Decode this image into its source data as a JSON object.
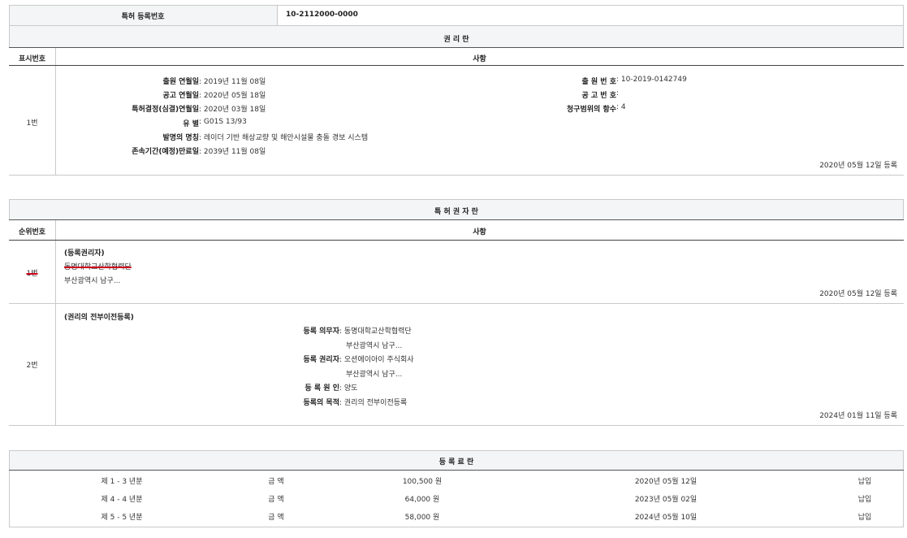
{
  "patent_number": {
    "label": "특허 등록번호",
    "value": "10-2112000-0000"
  },
  "rights_section": {
    "title": "권 리 란",
    "col_no": "표시번호",
    "col_content": "사항",
    "row": {
      "no": "1번",
      "left": [
        {
          "label": "출원 연월일",
          "value": "2019년 11월 08일"
        },
        {
          "label": "공고 연월일",
          "value": "2020년 05월 18일"
        },
        {
          "label": "특허결정(심결)연월일",
          "value": "2020년 03월 18일"
        },
        {
          "label": "유 별",
          "value": "G01S 13/93"
        },
        {
          "label": "발명의 명칭",
          "value": "레이더 기반 해상교량 및 해안시설물 충돌 경보 시스템"
        },
        {
          "label": "존속기간(예정)만료일",
          "value": "2039년 11월 08일"
        }
      ],
      "right": [
        {
          "label": "출 원 번 호",
          "value": "10-2019-0142749"
        },
        {
          "label": "공 고 번 호",
          "value": ""
        },
        {
          "label": "청구범위의 항수",
          "value": "4"
        }
      ],
      "date": "2020년 05월 12일 등록"
    }
  },
  "holder_section": {
    "title": "특 허 권 자 란",
    "col_no": "순위번호",
    "col_content": "사항",
    "row1": {
      "no": "1번",
      "type": "(등록권리자)",
      "name": "동명대학교산학협력단",
      "address": "부산광역시 남구...",
      "date": "2020년 05월 12일 등록"
    },
    "row2": {
      "no": "2번",
      "type": "(권리의 전부이전등록)",
      "lines": [
        {
          "label": "등록 의무자",
          "value": "동명대학교산학협력단"
        },
        {
          "label": "",
          "value": "부산광역시 남구..."
        },
        {
          "label": "등록 권리자",
          "value": "오션에이아이 주식회사"
        },
        {
          "label": "",
          "value": "부산광역시 남구..."
        },
        {
          "label": "등 록 원 인",
          "value": "양도"
        },
        {
          "label": "등록의 목적",
          "value": "권리의 전부이전등록"
        }
      ],
      "date": "2024년 01월 11일 등록"
    }
  },
  "fee_section": {
    "title": "등 록 료 란",
    "rows": [
      {
        "period": "제 1 - 3 년분",
        "label": "금 액",
        "amount": "100,500 원",
        "date": "2020년 05월 12일",
        "status": "납입"
      },
      {
        "period": "제 4 - 4 년분",
        "label": "금 액",
        "amount": "64,000 원",
        "date": "2023년 05월 02일",
        "status": "납입"
      },
      {
        "period": "제 5 - 5 년분",
        "label": "금 액",
        "amount": "58,000 원",
        "date": "2024년 05월 10일",
        "status": "납입"
      }
    ]
  }
}
